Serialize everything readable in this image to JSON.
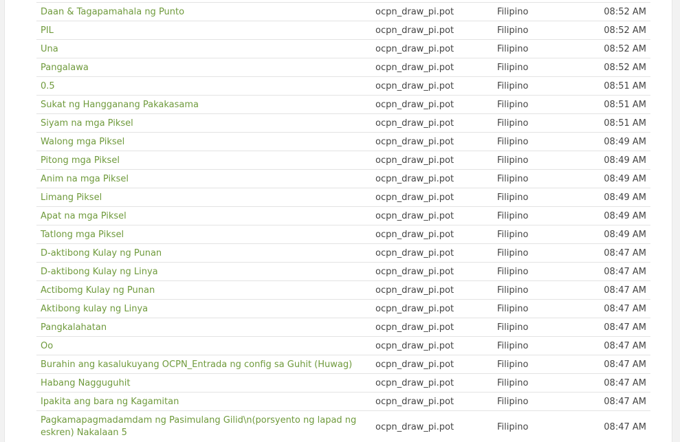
{
  "rows": [
    {
      "string": "Daan & Tagapamahala ng Punto",
      "file": "ocpn_draw_pi.pot",
      "language": "Filipino",
      "time": "08:52 AM"
    },
    {
      "string": "PIL",
      "file": "ocpn_draw_pi.pot",
      "language": "Filipino",
      "time": "08:52 AM"
    },
    {
      "string": "Una",
      "file": "ocpn_draw_pi.pot",
      "language": "Filipino",
      "time": "08:52 AM"
    },
    {
      "string": "Pangalawa",
      "file": "ocpn_draw_pi.pot",
      "language": "Filipino",
      "time": "08:52 AM"
    },
    {
      "string": "0.5",
      "file": "ocpn_draw_pi.pot",
      "language": "Filipino",
      "time": "08:51 AM"
    },
    {
      "string": "Sukat ng Hangganang Pakakasama",
      "file": "ocpn_draw_pi.pot",
      "language": "Filipino",
      "time": "08:51 AM"
    },
    {
      "string": "Siyam na mga Piksel",
      "file": "ocpn_draw_pi.pot",
      "language": "Filipino",
      "time": "08:51 AM"
    },
    {
      "string": "Walong mga Piksel",
      "file": "ocpn_draw_pi.pot",
      "language": "Filipino",
      "time": "08:49 AM"
    },
    {
      "string": "Pitong mga Piksel",
      "file": "ocpn_draw_pi.pot",
      "language": "Filipino",
      "time": "08:49 AM"
    },
    {
      "string": "Anim na mga Piksel",
      "file": "ocpn_draw_pi.pot",
      "language": "Filipino",
      "time": "08:49 AM"
    },
    {
      "string": "Limang Piksel",
      "file": "ocpn_draw_pi.pot",
      "language": "Filipino",
      "time": "08:49 AM"
    },
    {
      "string": "Apat na mga Piksel",
      "file": "ocpn_draw_pi.pot",
      "language": "Filipino",
      "time": "08:49 AM"
    },
    {
      "string": "Tatlong mga Piksel",
      "file": "ocpn_draw_pi.pot",
      "language": "Filipino",
      "time": "08:49 AM"
    },
    {
      "string": "D-aktibong Kulay ng Punan",
      "file": "ocpn_draw_pi.pot",
      "language": "Filipino",
      "time": "08:47 AM"
    },
    {
      "string": "D-aktibong Kulay ng Linya",
      "file": "ocpn_draw_pi.pot",
      "language": "Filipino",
      "time": "08:47 AM"
    },
    {
      "string": "Actibomg Kulay ng Punan",
      "file": "ocpn_draw_pi.pot",
      "language": "Filipino",
      "time": "08:47 AM"
    },
    {
      "string": "Aktibong kulay ng Linya",
      "file": "ocpn_draw_pi.pot",
      "language": "Filipino",
      "time": "08:47 AM"
    },
    {
      "string": "Pangkalahatan",
      "file": "ocpn_draw_pi.pot",
      "language": "Filipino",
      "time": "08:47 AM"
    },
    {
      "string": "Oo",
      "file": "ocpn_draw_pi.pot",
      "language": "Filipino",
      "time": "08:47 AM"
    },
    {
      "string": "Burahin ang kasalukuyang OCPN_Entrada ng config sa Guhit (Huwag)",
      "file": "ocpn_draw_pi.pot",
      "language": "Filipino",
      "time": "08:47 AM"
    },
    {
      "string": "Habang Nagguguhit",
      "file": "ocpn_draw_pi.pot",
      "language": "Filipino",
      "time": "08:47 AM"
    },
    {
      "string": "Ipakita ang bara ng Kagamitan",
      "file": "ocpn_draw_pi.pot",
      "language": "Filipino",
      "time": "08:47 AM"
    },
    {
      "string": "Pagkamapagmadamdam ng Pasimulang Gilid\\n(porsyento ng lapad ng eskren) Nakalaan 5",
      "file": "ocpn_draw_pi.pot",
      "language": "Filipino",
      "time": "08:47 AM"
    }
  ]
}
